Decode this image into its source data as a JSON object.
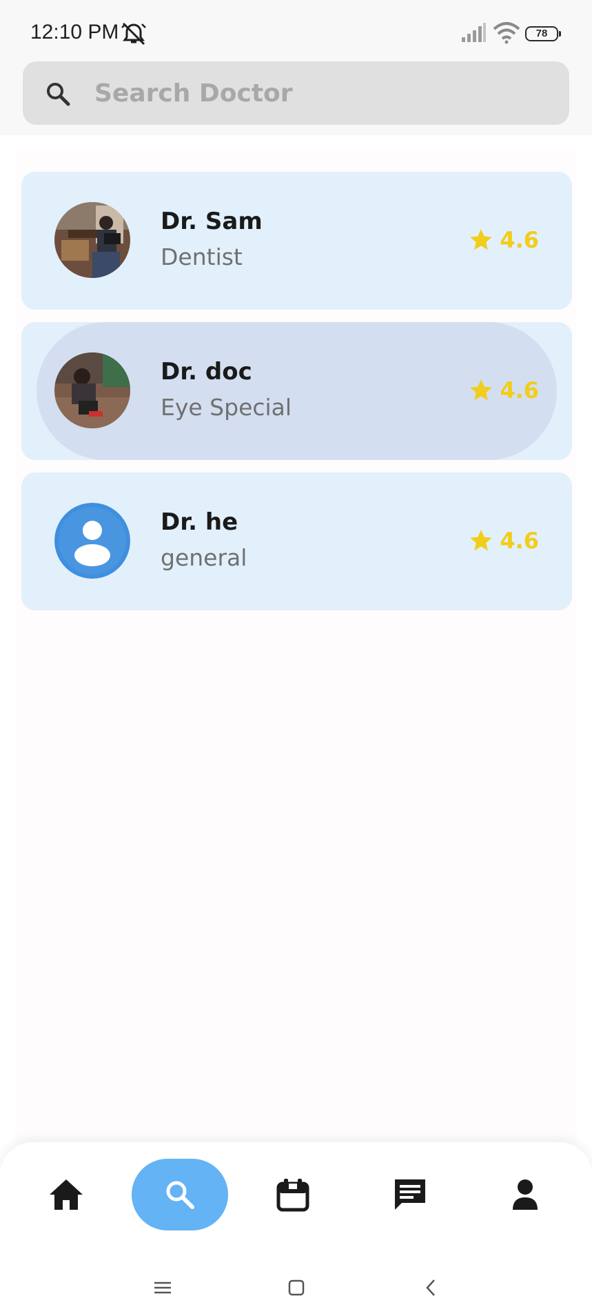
{
  "status_bar": {
    "time": "12:10 PM",
    "battery": "78",
    "icons": [
      "alarm-off-icon",
      "signal-icon",
      "wifi-icon",
      "battery-icon"
    ]
  },
  "search": {
    "placeholder": "Search Doctor",
    "value": "",
    "icon": "search-icon"
  },
  "doctors": [
    {
      "name": "Dr. Sam",
      "specialty": "Dentist",
      "rating": "4.6",
      "avatar": "photo"
    },
    {
      "name": "Dr. doc",
      "specialty": "Eye Special",
      "rating": "4.6",
      "avatar": "photo"
    },
    {
      "name": "Dr. he",
      "specialty": "general",
      "rating": "4.6",
      "avatar": "default-person"
    }
  ],
  "bottom_nav": {
    "items": [
      {
        "icon": "home-icon",
        "active": false
      },
      {
        "icon": "search-icon",
        "active": true
      },
      {
        "icon": "calendar-icon",
        "active": false
      },
      {
        "icon": "chat-icon",
        "active": false
      },
      {
        "icon": "profile-icon",
        "active": false
      }
    ]
  },
  "system_nav": [
    "menu-icon",
    "home-square-icon",
    "back-icon"
  ],
  "colors": {
    "card_bg": "#e2f0fb",
    "card_pressed": "#d3dff0",
    "rating": "#f2cd1a",
    "nav_active": "#63b3f5",
    "search_bg": "#e0e0e0"
  }
}
